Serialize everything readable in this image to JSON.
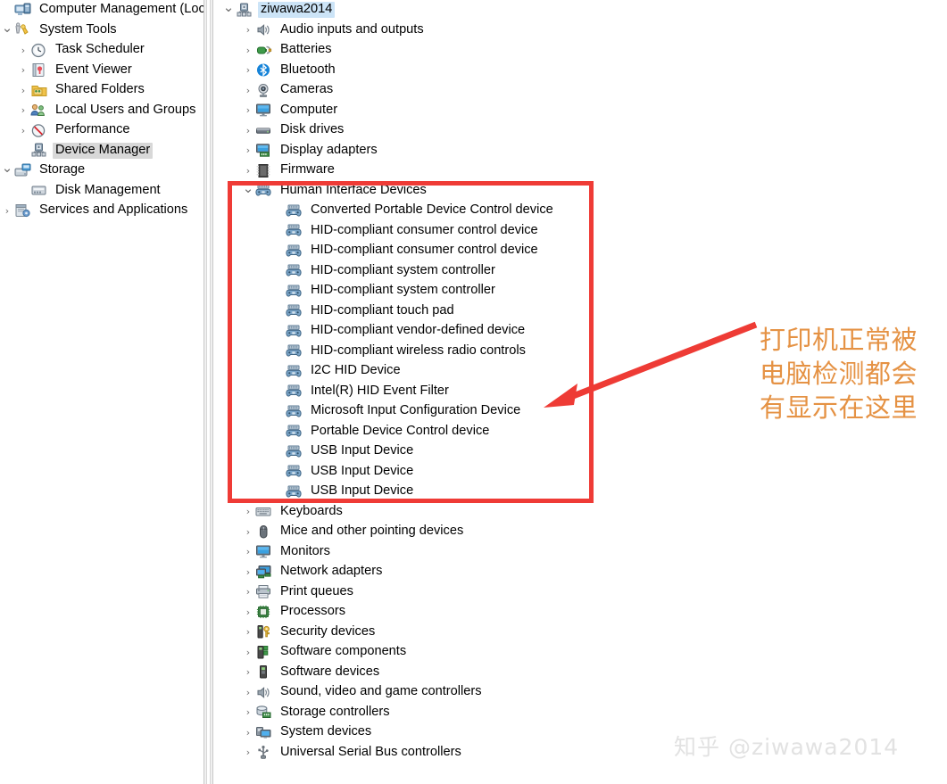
{
  "console": {
    "left_tree": [
      {
        "label": "Computer Management (Local)",
        "indent": 0,
        "chevron": "",
        "icon": "computer-management-icon",
        "selected": "none"
      },
      {
        "label": "System Tools",
        "indent": 0,
        "chevron": "v",
        "icon": "system-tools-icon",
        "selected": "none"
      },
      {
        "label": "Task Scheduler",
        "indent": 1,
        "chevron": ">",
        "icon": "clock-icon",
        "selected": "none"
      },
      {
        "label": "Event Viewer",
        "indent": 1,
        "chevron": ">",
        "icon": "event-viewer-icon",
        "selected": "none"
      },
      {
        "label": "Shared Folders",
        "indent": 1,
        "chevron": ">",
        "icon": "shared-folders-icon",
        "selected": "none"
      },
      {
        "label": "Local Users and Groups",
        "indent": 1,
        "chevron": ">",
        "icon": "users-groups-icon",
        "selected": "none"
      },
      {
        "label": "Performance",
        "indent": 1,
        "chevron": ">",
        "icon": "performance-icon",
        "selected": "none"
      },
      {
        "label": "Device Manager",
        "indent": 1,
        "chevron": "",
        "icon": "device-manager-icon",
        "selected": "gray"
      },
      {
        "label": "Storage",
        "indent": 0,
        "chevron": "v",
        "icon": "storage-icon",
        "selected": "none"
      },
      {
        "label": "Disk Management",
        "indent": 1,
        "chevron": "",
        "icon": "disk-management-icon",
        "selected": "none"
      },
      {
        "label": "Services and Applications",
        "indent": 0,
        "chevron": ">",
        "icon": "services-applications-icon",
        "selected": "none"
      }
    ],
    "device_tree": [
      {
        "label": "ziwawa2014",
        "indent": 0,
        "chevron": "v",
        "icon": "computer-node-icon",
        "selected": "blue"
      },
      {
        "label": "Audio inputs and outputs",
        "indent": 1,
        "chevron": ">",
        "icon": "speaker-icon",
        "selected": "none"
      },
      {
        "label": "Batteries",
        "indent": 1,
        "chevron": ">",
        "icon": "battery-icon",
        "selected": "none"
      },
      {
        "label": "Bluetooth",
        "indent": 1,
        "chevron": ">",
        "icon": "bluetooth-icon",
        "selected": "none"
      },
      {
        "label": "Cameras",
        "indent": 1,
        "chevron": ">",
        "icon": "camera-icon",
        "selected": "none"
      },
      {
        "label": "Computer",
        "indent": 1,
        "chevron": ">",
        "icon": "monitor-icon",
        "selected": "none"
      },
      {
        "label": "Disk drives",
        "indent": 1,
        "chevron": ">",
        "icon": "disk-drive-icon",
        "selected": "none"
      },
      {
        "label": "Display adapters",
        "indent": 1,
        "chevron": ">",
        "icon": "display-adapter-icon",
        "selected": "none"
      },
      {
        "label": "Firmware",
        "indent": 1,
        "chevron": ">",
        "icon": "firmware-icon",
        "selected": "none"
      },
      {
        "label": "Human Interface Devices",
        "indent": 1,
        "chevron": "v",
        "icon": "hid-icon",
        "selected": "none"
      },
      {
        "label": "Converted Portable Device Control device",
        "indent": 2,
        "chevron": "",
        "icon": "hid-icon",
        "selected": "none"
      },
      {
        "label": "HID-compliant consumer control device",
        "indent": 2,
        "chevron": "",
        "icon": "hid-icon",
        "selected": "none"
      },
      {
        "label": "HID-compliant consumer control device",
        "indent": 2,
        "chevron": "",
        "icon": "hid-icon",
        "selected": "none"
      },
      {
        "label": "HID-compliant system controller",
        "indent": 2,
        "chevron": "",
        "icon": "hid-icon",
        "selected": "none"
      },
      {
        "label": "HID-compliant system controller",
        "indent": 2,
        "chevron": "",
        "icon": "hid-icon",
        "selected": "none"
      },
      {
        "label": "HID-compliant touch pad",
        "indent": 2,
        "chevron": "",
        "icon": "hid-icon",
        "selected": "none"
      },
      {
        "label": "HID-compliant vendor-defined device",
        "indent": 2,
        "chevron": "",
        "icon": "hid-icon",
        "selected": "none"
      },
      {
        "label": "HID-compliant wireless radio controls",
        "indent": 2,
        "chevron": "",
        "icon": "hid-icon",
        "selected": "none"
      },
      {
        "label": "I2C HID Device",
        "indent": 2,
        "chevron": "",
        "icon": "hid-icon",
        "selected": "none"
      },
      {
        "label": "Intel(R) HID Event Filter",
        "indent": 2,
        "chevron": "",
        "icon": "hid-icon",
        "selected": "none"
      },
      {
        "label": "Microsoft Input Configuration Device",
        "indent": 2,
        "chevron": "",
        "icon": "hid-icon",
        "selected": "none"
      },
      {
        "label": "Portable Device Control device",
        "indent": 2,
        "chevron": "",
        "icon": "hid-icon",
        "selected": "none"
      },
      {
        "label": "USB Input Device",
        "indent": 2,
        "chevron": "",
        "icon": "hid-icon",
        "selected": "none"
      },
      {
        "label": "USB Input Device",
        "indent": 2,
        "chevron": "",
        "icon": "hid-icon",
        "selected": "none"
      },
      {
        "label": "USB Input Device",
        "indent": 2,
        "chevron": "",
        "icon": "hid-icon",
        "selected": "none"
      },
      {
        "label": "Keyboards",
        "indent": 1,
        "chevron": ">",
        "icon": "keyboard-icon",
        "selected": "none"
      },
      {
        "label": "Mice and other pointing devices",
        "indent": 1,
        "chevron": ">",
        "icon": "mouse-icon",
        "selected": "none"
      },
      {
        "label": "Monitors",
        "indent": 1,
        "chevron": ">",
        "icon": "monitor-icon",
        "selected": "none"
      },
      {
        "label": "Network adapters",
        "indent": 1,
        "chevron": ">",
        "icon": "network-adapter-icon",
        "selected": "none"
      },
      {
        "label": "Print queues",
        "indent": 1,
        "chevron": ">",
        "icon": "printer-icon",
        "selected": "none"
      },
      {
        "label": "Processors",
        "indent": 1,
        "chevron": ">",
        "icon": "processor-icon",
        "selected": "none"
      },
      {
        "label": "Security devices",
        "indent": 1,
        "chevron": ">",
        "icon": "security-device-icon",
        "selected": "none"
      },
      {
        "label": "Software components",
        "indent": 1,
        "chevron": ">",
        "icon": "software-component-icon",
        "selected": "none"
      },
      {
        "label": "Software devices",
        "indent": 1,
        "chevron": ">",
        "icon": "software-device-icon",
        "selected": "none"
      },
      {
        "label": "Sound, video and game controllers",
        "indent": 1,
        "chevron": ">",
        "icon": "speaker-icon",
        "selected": "none"
      },
      {
        "label": "Storage controllers",
        "indent": 1,
        "chevron": ">",
        "icon": "storage-controller-icon",
        "selected": "none"
      },
      {
        "label": "System devices",
        "indent": 1,
        "chevron": ">",
        "icon": "system-device-icon",
        "selected": "none"
      },
      {
        "label": "Universal Serial Bus controllers",
        "indent": 1,
        "chevron": ">",
        "icon": "usb-icon",
        "selected": "none"
      }
    ]
  },
  "annotation": {
    "callout_text": "打印机正常被电脑检测都会有显示在这里",
    "callout_color": "#e59244",
    "box_color": "#ef3b36",
    "arrow_color": "#ee3b35"
  },
  "watermark": {
    "text": "知乎 @ziwawa2014"
  }
}
